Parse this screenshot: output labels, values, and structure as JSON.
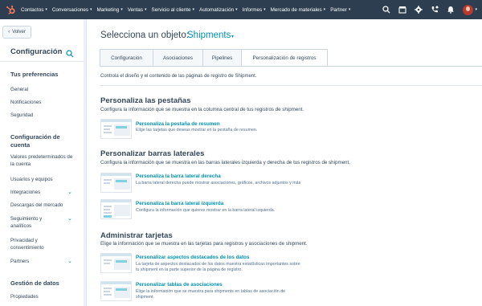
{
  "topnav": {
    "items": [
      "Contactos",
      "Conversaciones",
      "Marketing",
      "Ventas",
      "Servicio al cliente",
      "Automatización",
      "Informes",
      "Mercado de materiales",
      "Partner"
    ],
    "caret": "▾"
  },
  "sidebar": {
    "back_label": "Volver",
    "title": "Configuración",
    "sections": [
      {
        "heading": "Tus preferencias",
        "items": [
          "General",
          "Notificaciones",
          "Seguridad"
        ]
      },
      {
        "heading": "Configuración de cuenta",
        "items": [
          "Valores predeterminados de la cuenta",
          "Usuarios y equipos",
          "Integraciones",
          "Descargas del mercado",
          "Seguimiento y analíticos",
          "Privacidad y consentimiento",
          "Partners"
        ]
      },
      {
        "heading": "Gestión de datos",
        "items": [
          "Propiedades"
        ]
      }
    ]
  },
  "main": {
    "object_label": "Selecciona un objeto:",
    "object_value": "Shipments",
    "tabs": [
      "Configuración",
      "Asociaciones",
      "Pipelines",
      "Personalización de registros"
    ],
    "active_tab": "Personalización de registros",
    "description": "Controla el diseño y el contenido de las páginas de registro de Shipment.",
    "sections": [
      {
        "title": "Personaliza las pestañas",
        "subtitle": "Configura la información que se muestra en la columna central de tus registros de shipment.",
        "cards": [
          {
            "title": "Personaliza la pestaña de resumen",
            "desc": "Elige las tarjetas que deseas mostrar en la pestaña de resumen."
          }
        ]
      },
      {
        "title": "Personalizar barras laterales",
        "subtitle": "Configura la información que se muestra en las barras laterales izquierda y derecha de tus registros de shipment.",
        "cards": [
          {
            "title": "Personaliza la barra lateral derecha",
            "desc": "La barra lateral derecha puede mostrar asociaciones, gráficos, archivos adjuntos y más"
          },
          {
            "title": "Personaliza la barra lateral izquierda",
            "desc": "Configura la información que quieres mostrar en la barra lateral izquierda."
          }
        ]
      },
      {
        "title": "Administrar tarjetas",
        "subtitle": "Elige la información que se muestra en las tarjetas para registros y asociaciones de shipment.",
        "cards": [
          {
            "title": "Personalizar aspectos destacados de los datos",
            "desc_lines": [
              "La tarjeta de aspectos destacados de los datos muestra estadísticas importantes sobre",
              "tu shipment en la parte superior de la página de registro."
            ]
          },
          {
            "title": "Personalizar tablas de asociaciones",
            "desc_lines": [
              "Elige la información que se muestra para shipments en tablas de asociación de",
              "shipment."
            ]
          }
        ]
      }
    ]
  },
  "colors": {
    "nav_bg": "#2d3e50",
    "link": "#0091ae",
    "text": "#33475b",
    "logo": "#ff7a59"
  }
}
